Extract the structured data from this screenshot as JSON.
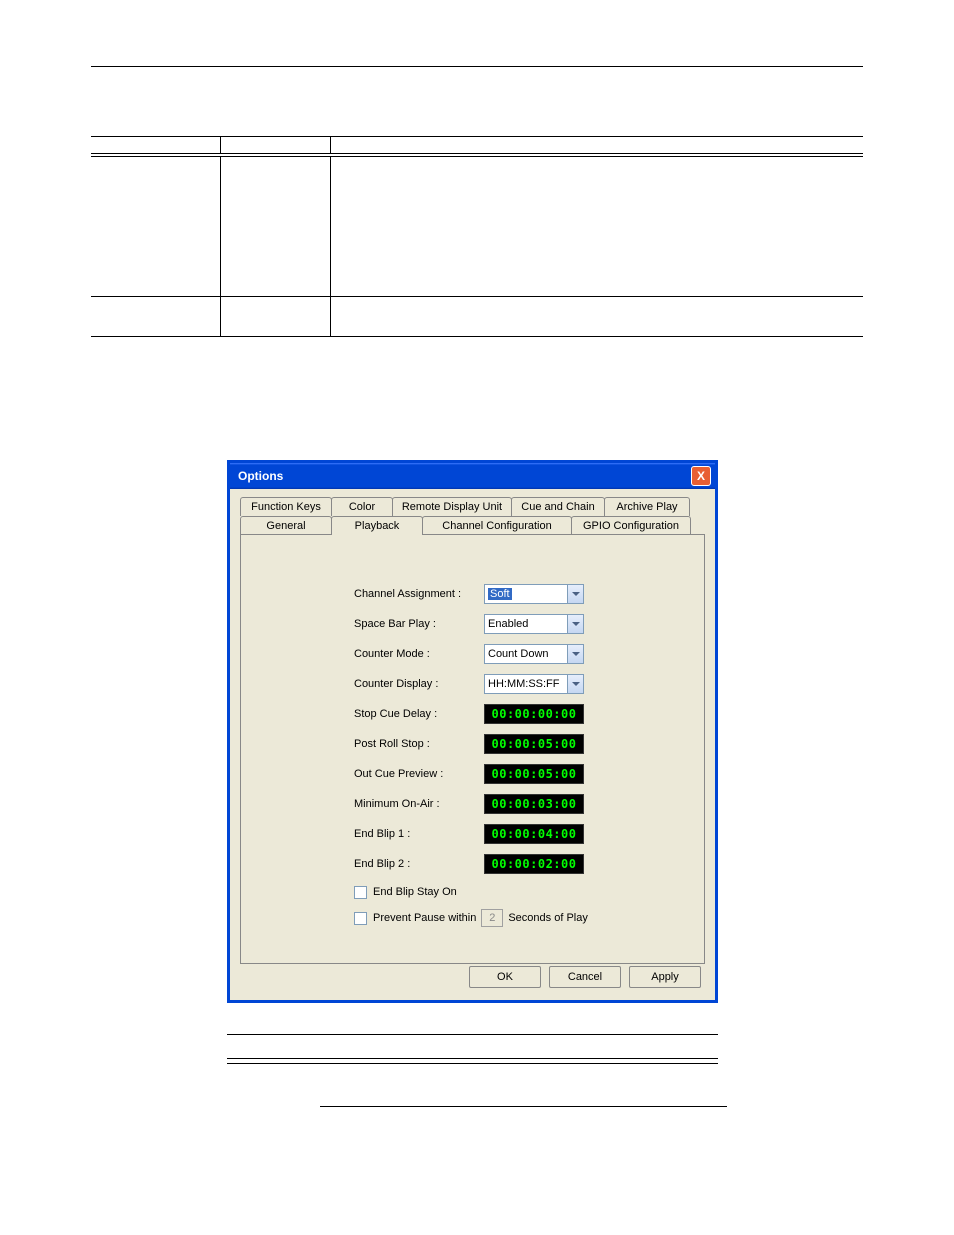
{
  "table": {
    "header_col1": "",
    "header_col2": "",
    "header_col3": "",
    "row1": {
      "c1": "",
      "c2": "",
      "c3": ""
    },
    "row2": {
      "c1": "",
      "c2": "",
      "c3": ""
    }
  },
  "dialog": {
    "title": "Options",
    "close_icon": "X",
    "tabs_row1": {
      "t0": "Function Keys",
      "t1": "Color",
      "t2": "Remote Display Unit",
      "t3": "Cue and Chain",
      "t4": "Archive Play"
    },
    "tabs_row2": {
      "t0": "General",
      "t1": "Playback",
      "t2": "Channel Configuration",
      "t3": "GPIO Configuration"
    },
    "fields": {
      "channel_assignment": {
        "label": "Channel Assignment :",
        "value": "Soft"
      },
      "space_bar_play": {
        "label": "Space Bar Play :",
        "value": "Enabled"
      },
      "counter_mode": {
        "label": "Counter Mode :",
        "value": "Count Down"
      },
      "counter_display": {
        "label": "Counter Display :",
        "value": "HH:MM:SS:FF"
      },
      "stop_cue_delay": {
        "label": "Stop Cue Delay :",
        "value": "00:00:00:00"
      },
      "post_roll_stop": {
        "label": "Post Roll Stop :",
        "value": "00:00:05:00"
      },
      "out_cue_preview": {
        "label": "Out Cue Preview  :",
        "value": "00:00:05:00"
      },
      "minimum_on_air": {
        "label": "Minimum On-Air :",
        "value": "00:00:03:00"
      },
      "end_blip_1": {
        "label": "End Blip 1 :",
        "value": "00:00:04:00"
      },
      "end_blip_2": {
        "label": "End Blip 2 :",
        "value": "00:00:02:00"
      }
    },
    "checks": {
      "end_blip_stay_on": "End Blip Stay On",
      "prevent_pause_pre": "Prevent Pause within",
      "prevent_pause_value": "2",
      "prevent_pause_post": "Seconds of Play"
    },
    "buttons": {
      "ok": "OK",
      "cancel": "Cancel",
      "apply": "Apply"
    }
  },
  "desc_table": {
    "h1": "",
    "h2": ""
  }
}
